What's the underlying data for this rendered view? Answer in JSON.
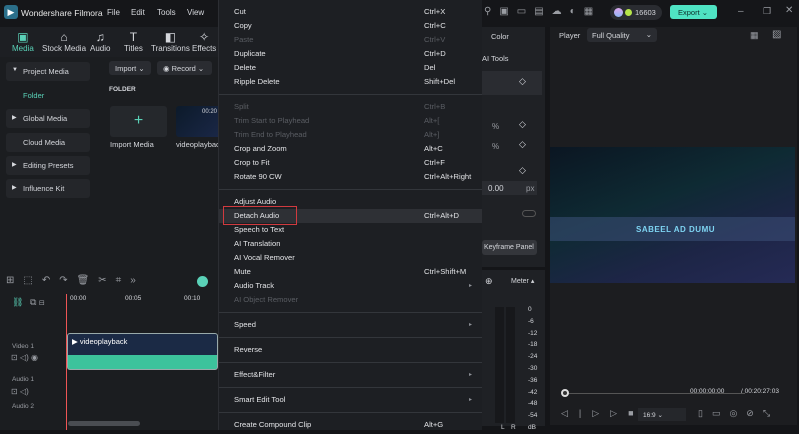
{
  "app": {
    "title": "Wondershare Filmora",
    "menu": [
      "File",
      "Edit",
      "Tools",
      "View"
    ],
    "credits": "16603",
    "export": "Export"
  },
  "toolbar": [
    {
      "label": "Media",
      "icon": "media-icon"
    },
    {
      "label": "Stock Media",
      "icon": "stock-icon"
    },
    {
      "label": "Audio",
      "icon": "music-icon"
    },
    {
      "label": "Titles",
      "icon": "titles-icon"
    },
    {
      "label": "Transitions",
      "icon": "transitions-icon"
    },
    {
      "label": "Effects",
      "icon": "effects-icon"
    }
  ],
  "sidebar": {
    "items": [
      "Project Media",
      "Folder",
      "Global Media",
      "Cloud Media",
      "Editing Presets",
      "Influence Kit"
    ]
  },
  "media": {
    "import": "Import",
    "record": "Record",
    "folder_label": "FOLDER",
    "import_media": "Import Media",
    "clip_name": "videoplayback",
    "clip_time": "00:20"
  },
  "context_menu": [
    {
      "label": "Cut",
      "shortcut": "Ctrl+X"
    },
    {
      "label": "Copy",
      "shortcut": "Ctrl+C"
    },
    {
      "label": "Paste",
      "shortcut": "Ctrl+V",
      "disabled": true
    },
    {
      "label": "Duplicate",
      "shortcut": "Ctrl+D"
    },
    {
      "label": "Delete",
      "shortcut": "Del"
    },
    {
      "label": "Ripple Delete",
      "shortcut": "Shift+Del"
    },
    {
      "sep": true
    },
    {
      "label": "Split",
      "shortcut": "Ctrl+B",
      "disabled": true
    },
    {
      "label": "Trim Start to Playhead",
      "shortcut": "Alt+[",
      "disabled": true
    },
    {
      "label": "Trim End to Playhead",
      "shortcut": "Alt+]",
      "disabled": true
    },
    {
      "label": "Crop and Zoom",
      "shortcut": "Alt+C"
    },
    {
      "label": "Crop to Fit",
      "shortcut": "Ctrl+F"
    },
    {
      "label": "Rotate 90 CW",
      "shortcut": "Ctrl+Alt+Right"
    },
    {
      "sep": true
    },
    {
      "label": "Adjust Audio",
      "shortcut": ""
    },
    {
      "label": "Detach Audio",
      "shortcut": "Ctrl+Alt+D",
      "highlighted": true
    },
    {
      "label": "Speech to Text",
      "shortcut": ""
    },
    {
      "label": "AI Translation",
      "shortcut": ""
    },
    {
      "label": "AI Vocal Remover",
      "shortcut": ""
    },
    {
      "label": "Mute",
      "shortcut": "Ctrl+Shift+M"
    },
    {
      "label": "Audio Track",
      "shortcut": "",
      "submenu": true
    },
    {
      "label": "AI Object Remover",
      "shortcut": "",
      "disabled": true
    },
    {
      "sep": true
    },
    {
      "label": "Speed",
      "shortcut": "",
      "submenu": true
    },
    {
      "sep": true
    },
    {
      "label": "Reverse",
      "shortcut": ""
    },
    {
      "sep": true
    },
    {
      "label": "Effect&Filter",
      "shortcut": "",
      "submenu": true
    },
    {
      "sep": true
    },
    {
      "label": "Smart Edit Tool",
      "shortcut": "",
      "submenu": true
    },
    {
      "sep": true
    },
    {
      "label": "Create Compound Clip",
      "shortcut": "Alt+G"
    }
  ],
  "props": {
    "tab_color": "Color",
    "tab_ai": "AI Tools",
    "unit_pct": "%",
    "value": "0.00",
    "unit_px": "px",
    "keyframe_panel": "Keyframe Panel"
  },
  "player": {
    "label": "Player",
    "quality": "Full Quality",
    "overlay_text": "SABEEL AD DUMU",
    "current": "00:00:00:00",
    "total": "/ 00:20:27:03",
    "ratio": "16:9",
    "progress": 0
  },
  "meter": {
    "label": "Meter",
    "scale": [
      "0",
      "-6",
      "-12",
      "-18",
      "-24",
      "-30",
      "-36",
      "-42",
      "-48",
      "-54",
      "dB"
    ],
    "left": "L",
    "right": "R"
  },
  "timeline": {
    "ticks": [
      "00:00",
      "00:05",
      "00:10"
    ],
    "tracks": [
      "Video 1",
      "Audio 1",
      "Audio 2"
    ],
    "clip": "videoplayback"
  }
}
